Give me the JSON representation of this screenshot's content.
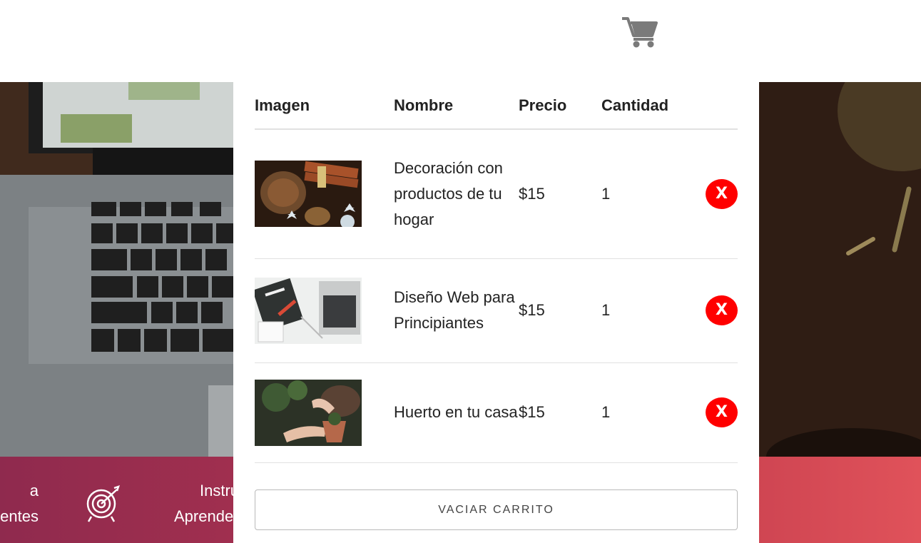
{
  "header": {
    "cart_icon": "cart-icon"
  },
  "band": {
    "left_text_line1": "a",
    "left_text_line2": "entes",
    "target_icon": "target-icon",
    "middle_text_line1": "Instru",
    "middle_text_line2": "Aprende"
  },
  "cart": {
    "headers": {
      "image": "Imagen",
      "name": "Nombre",
      "price": "Precio",
      "quantity": "Cantidad"
    },
    "items": [
      {
        "name": "Decoración con productos de tu hogar",
        "price": "$15",
        "quantity": "1",
        "delete_label": "X"
      },
      {
        "name": "Diseño Web para Principiantes",
        "price": "$15",
        "quantity": "1",
        "delete_label": "X"
      },
      {
        "name": "Huerto en tu casa",
        "price": "$15",
        "quantity": "1",
        "delete_label": "X"
      }
    ],
    "empty_button": "VACIAR CARRITO"
  },
  "colors": {
    "delete": "#ff0000",
    "band_start": "#8f2a4e",
    "band_end": "#e0525a"
  }
}
